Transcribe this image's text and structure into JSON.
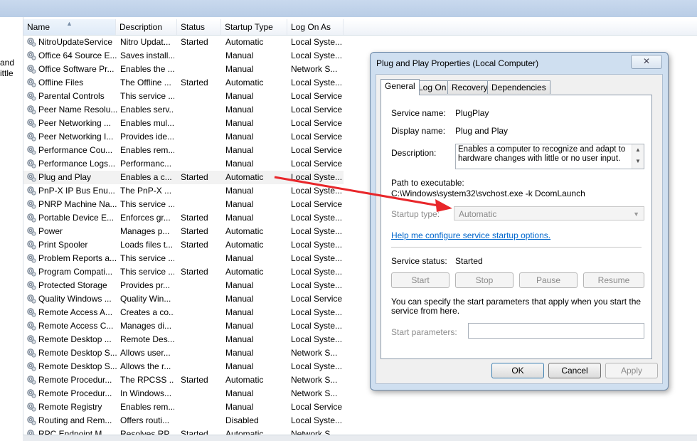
{
  "left_fragment": [
    "and",
    "ittle"
  ],
  "columns": [
    "Name",
    "Description",
    "Status",
    "Startup Type",
    "Log On As"
  ],
  "services": [
    {
      "name": "NitroUpdateService",
      "desc": "Nitro Updat...",
      "status": "Started",
      "type": "Automatic",
      "logon": "Local Syste..."
    },
    {
      "name": "Office 64 Source E...",
      "desc": "Saves install...",
      "status": "",
      "type": "Manual",
      "logon": "Local Syste..."
    },
    {
      "name": "Office Software Pr...",
      "desc": "Enables the ...",
      "status": "",
      "type": "Manual",
      "logon": "Network S..."
    },
    {
      "name": "Offline Files",
      "desc": "The Offline ...",
      "status": "Started",
      "type": "Automatic",
      "logon": "Local Syste..."
    },
    {
      "name": "Parental Controls",
      "desc": "This service ...",
      "status": "",
      "type": "Manual",
      "logon": "Local Service"
    },
    {
      "name": "Peer Name Resolu...",
      "desc": "Enables serv...",
      "status": "",
      "type": "Manual",
      "logon": "Local Service"
    },
    {
      "name": "Peer Networking ...",
      "desc": "Enables mul...",
      "status": "",
      "type": "Manual",
      "logon": "Local Service"
    },
    {
      "name": "Peer Networking I...",
      "desc": "Provides ide...",
      "status": "",
      "type": "Manual",
      "logon": "Local Service"
    },
    {
      "name": "Performance Cou...",
      "desc": "Enables rem...",
      "status": "",
      "type": "Manual",
      "logon": "Local Service"
    },
    {
      "name": "Performance Logs...",
      "desc": "Performanc...",
      "status": "",
      "type": "Manual",
      "logon": "Local Service"
    },
    {
      "name": "Plug and Play",
      "desc": "Enables a c...",
      "status": "Started",
      "type": "Automatic",
      "logon": "Local Syste..."
    },
    {
      "name": "PnP-X IP Bus Enu...",
      "desc": "The PnP-X ...",
      "status": "",
      "type": "Manual",
      "logon": "Local Syste..."
    },
    {
      "name": "PNRP Machine Na...",
      "desc": "This service ...",
      "status": "",
      "type": "Manual",
      "logon": "Local Service"
    },
    {
      "name": "Portable Device E...",
      "desc": "Enforces gr...",
      "status": "Started",
      "type": "Manual",
      "logon": "Local Syste..."
    },
    {
      "name": "Power",
      "desc": "Manages p...",
      "status": "Started",
      "type": "Automatic",
      "logon": "Local Syste..."
    },
    {
      "name": "Print Spooler",
      "desc": "Loads files t...",
      "status": "Started",
      "type": "Automatic",
      "logon": "Local Syste..."
    },
    {
      "name": "Problem Reports a...",
      "desc": "This service ...",
      "status": "",
      "type": "Manual",
      "logon": "Local Syste..."
    },
    {
      "name": "Program Compati...",
      "desc": "This service ...",
      "status": "Started",
      "type": "Automatic",
      "logon": "Local Syste..."
    },
    {
      "name": "Protected Storage",
      "desc": "Provides pr...",
      "status": "",
      "type": "Manual",
      "logon": "Local Syste..."
    },
    {
      "name": "Quality Windows ...",
      "desc": "Quality Win...",
      "status": "",
      "type": "Manual",
      "logon": "Local Service"
    },
    {
      "name": "Remote Access A...",
      "desc": "Creates a co...",
      "status": "",
      "type": "Manual",
      "logon": "Local Syste..."
    },
    {
      "name": "Remote Access C...",
      "desc": "Manages di...",
      "status": "",
      "type": "Manual",
      "logon": "Local Syste..."
    },
    {
      "name": "Remote Desktop ...",
      "desc": "Remote Des...",
      "status": "",
      "type": "Manual",
      "logon": "Local Syste..."
    },
    {
      "name": "Remote Desktop S...",
      "desc": "Allows user...",
      "status": "",
      "type": "Manual",
      "logon": "Network S..."
    },
    {
      "name": "Remote Desktop S...",
      "desc": "Allows the r...",
      "status": "",
      "type": "Manual",
      "logon": "Local Syste..."
    },
    {
      "name": "Remote Procedur...",
      "desc": "The RPCSS ...",
      "status": "Started",
      "type": "Automatic",
      "logon": "Network S..."
    },
    {
      "name": "Remote Procedur...",
      "desc": "In Windows...",
      "status": "",
      "type": "Manual",
      "logon": "Network S..."
    },
    {
      "name": "Remote Registry",
      "desc": "Enables rem...",
      "status": "",
      "type": "Manual",
      "logon": "Local Service"
    },
    {
      "name": "Routing and Rem...",
      "desc": "Offers routi...",
      "status": "",
      "type": "Disabled",
      "logon": "Local Syste..."
    },
    {
      "name": "RPC Endpoint M...",
      "desc": "Resolves RP...",
      "status": "Started",
      "type": "Automatic",
      "logon": "Network S..."
    }
  ],
  "selected_service_index": 10,
  "dialog": {
    "title": "Plug and Play Properties (Local Computer)",
    "close_glyph": "✕",
    "tabs": [
      "General",
      "Log On",
      "Recovery",
      "Dependencies"
    ],
    "active_tab": "General",
    "service_name_label": "Service name:",
    "service_name": "PlugPlay",
    "display_name_label": "Display name:",
    "display_name": "Plug and Play",
    "description_label": "Description:",
    "description": "Enables a computer to recognize and adapt to hardware changes with little or no user input.",
    "path_label": "Path to executable:",
    "path": "C:\\Windows\\system32\\svchost.exe -k DcomLaunch",
    "startup_type_label": "Startup type:",
    "startup_type": "Automatic",
    "help_link": "Help me configure service startup options.",
    "service_status_label": "Service status:",
    "service_status": "Started",
    "start_label": "Start",
    "stop_label": "Stop",
    "pause_label": "Pause",
    "resume_label": "Resume",
    "params_note": "You can specify the start parameters that apply when you start the service from here.",
    "start_params_label": "Start parameters:",
    "start_params_value": "",
    "ok_label": "OK",
    "cancel_label": "Cancel",
    "apply_label": "Apply"
  },
  "colors": {
    "annotation_arrow": "#e8262a",
    "link": "#0066cc",
    "titlebar": "#c9d9ee"
  }
}
